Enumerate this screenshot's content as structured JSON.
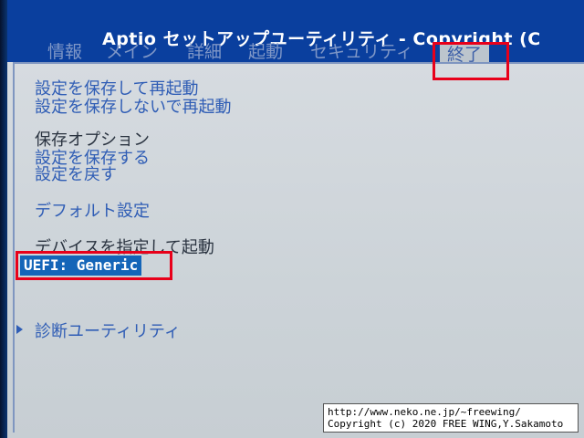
{
  "header": {
    "title": "Aptio セットアップユーティリティ - Copyright (C"
  },
  "menu": {
    "tabs": [
      {
        "label": "情報"
      },
      {
        "label": "メイン"
      },
      {
        "label": "詳細"
      },
      {
        "label": "起動"
      },
      {
        "label": "セキュリティ"
      },
      {
        "label": "終了",
        "active": true
      }
    ]
  },
  "exit_menu": {
    "save_and_restart": "設定を保存して再起動",
    "discard_and_restart": "設定を保存しないで再起動",
    "save_options_heading": "保存オプション",
    "save_settings": "設定を保存する",
    "restore_settings": "設定を戻す",
    "default_settings": "デフォルト設定",
    "boot_device_heading": "デバイスを指定して起動",
    "boot_device_selected": "UEFI: Generic",
    "diagnostics": "診断ユーティリティ"
  },
  "credit": {
    "line1": "http://www.neko.ne.jp/~freewing/",
    "line2": "Copyright (c) 2020 FREE WING,Y.Sakamoto"
  },
  "colors": {
    "background": "#0a3f9e",
    "panel": "#d2d8dd",
    "link": "#2f5db5",
    "selection": "#1465b8",
    "highlight": "#e8001a"
  }
}
